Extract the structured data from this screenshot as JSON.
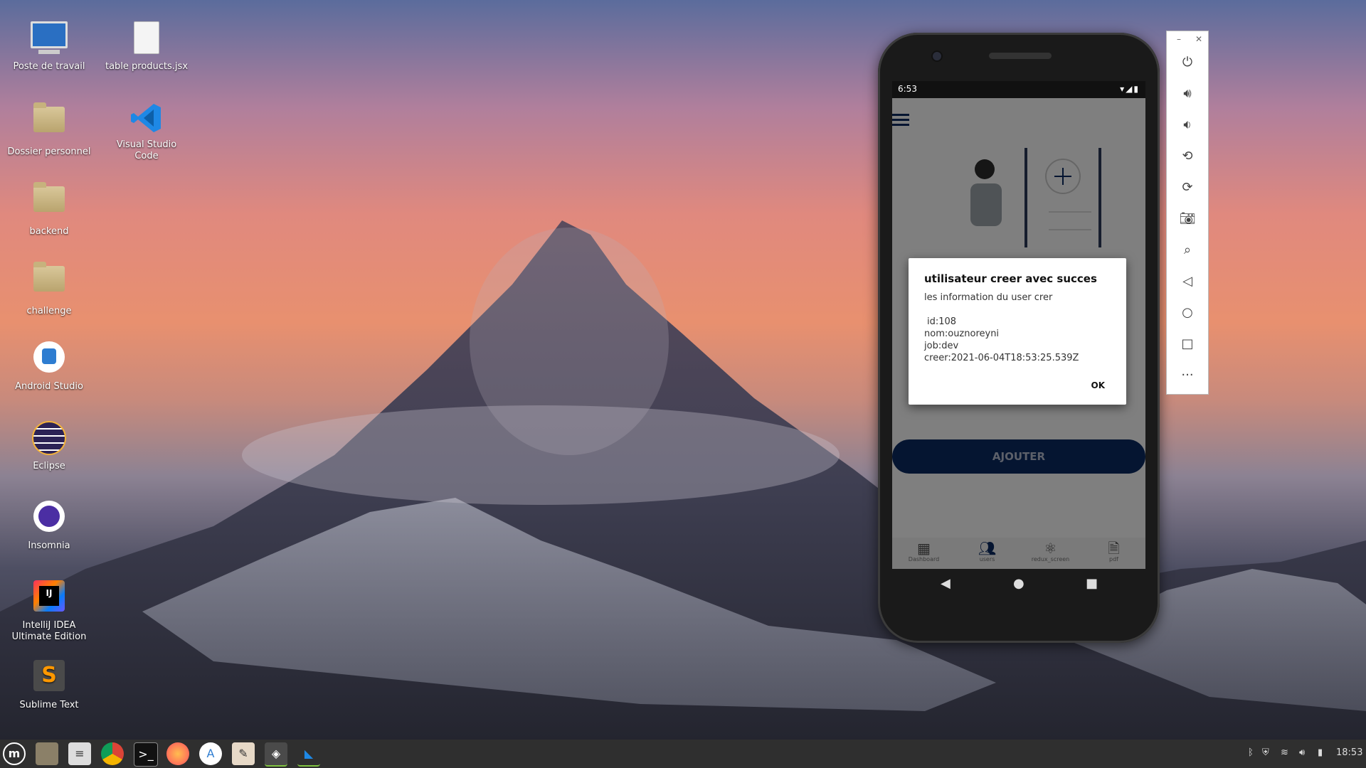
{
  "desktop": {
    "icons": [
      {
        "label": "Poste de travail"
      },
      {
        "label": "table products.jsx"
      },
      {
        "label": "Dossier personnel"
      },
      {
        "label": "Visual Studio Code"
      },
      {
        "label": "backend"
      },
      {
        "label": "challenge"
      },
      {
        "label": "Android Studio"
      },
      {
        "label": "Eclipse"
      },
      {
        "label": "Insomnia"
      },
      {
        "label": "IntelliJ IDEA Ultimate Edition"
      },
      {
        "label": "Sublime Text"
      }
    ]
  },
  "phone": {
    "status_time": "6:53",
    "status_icons": "▾◢▮",
    "add_button": "AJOUTER",
    "tabs": [
      "Dashboard",
      "users",
      "redux_screen",
      "pdf"
    ]
  },
  "dialog": {
    "title": "utilisateur creer avec succes",
    "subtitle": "les information du user crer",
    "id": "id:108",
    "nom": "nom:ouznoreyni",
    "job": "job:dev",
    "creer": "creer:2021-06-04T18:53:25.539Z",
    "ok": "OK"
  },
  "taskbar": {
    "time": "18:53"
  },
  "colors": {
    "taskbar": "#2f2f2f",
    "button_primary": "#0b2a62"
  }
}
